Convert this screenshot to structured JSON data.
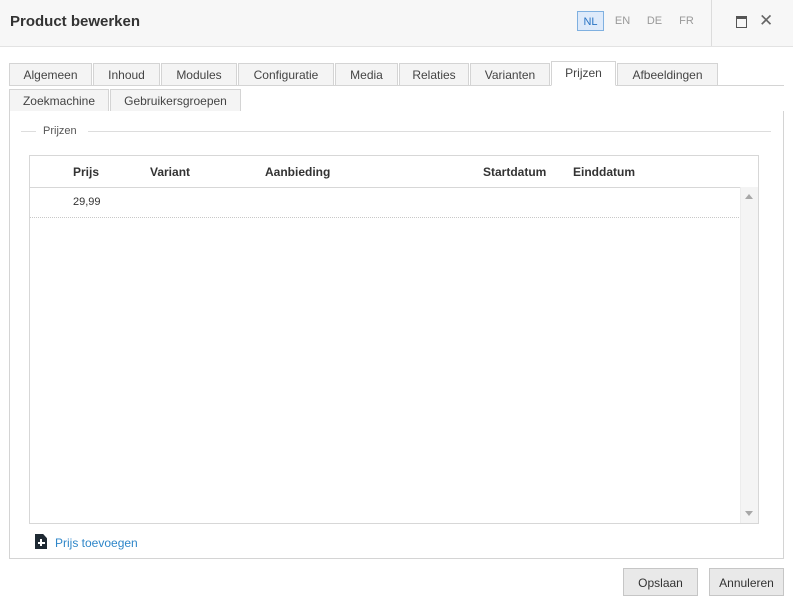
{
  "window": {
    "title": "Product bewerken",
    "languages": [
      "NL",
      "EN",
      "DE",
      "FR"
    ],
    "active_language": "NL"
  },
  "tabs": {
    "row1": [
      "Algemeen",
      "Inhoud",
      "Modules",
      "Configuratie",
      "Media",
      "Relaties",
      "Varianten",
      "Prijzen",
      "Afbeeldingen"
    ],
    "row2": [
      "Zoekmachine",
      "Gebruikersgroepen"
    ],
    "active": "Prijzen"
  },
  "section": {
    "legend": "Prijzen"
  },
  "grid": {
    "columns": [
      "Prijs",
      "Variant",
      "Aanbieding",
      "Startdatum",
      "Einddatum"
    ],
    "rows": [
      [
        "29,99",
        "",
        "",
        "",
        ""
      ]
    ]
  },
  "actions": {
    "add_price": "Prijs toevoegen",
    "save": "Opslaan",
    "cancel": "Annuleren"
  },
  "colors": {
    "accent": "#2e86c9",
    "active_lang_bg": "#deeafa",
    "active_lang_border": "#7fb0e0"
  },
  "icons": {
    "maximize": "maximize-icon",
    "close": "close-icon",
    "add": "file-plus-icon",
    "scroll_up": "chevron-up-icon",
    "scroll_down": "chevron-down-icon"
  }
}
